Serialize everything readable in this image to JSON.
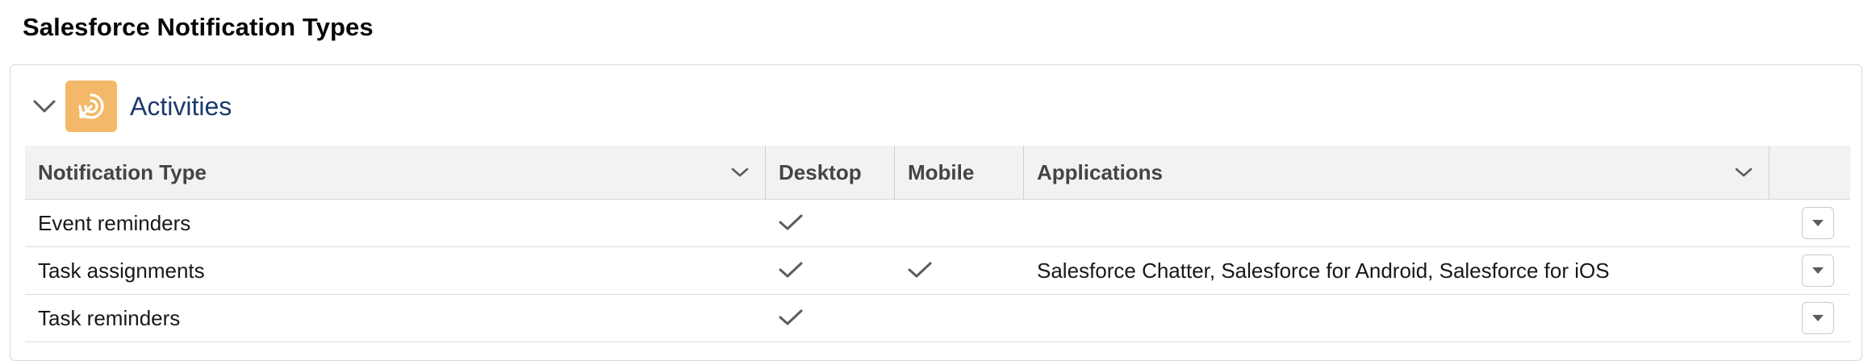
{
  "page": {
    "title": "Salesforce Notification Types"
  },
  "section": {
    "title": "Activities",
    "icon": "activity-icon",
    "collapse_icon": "chevron-down-icon",
    "accent_color": "#f3b968"
  },
  "table": {
    "columns": [
      {
        "label": "Notification Type",
        "sortable": true
      },
      {
        "label": "Desktop",
        "sortable": false
      },
      {
        "label": "Mobile",
        "sortable": false
      },
      {
        "label": "Applications",
        "sortable": true
      }
    ],
    "rows": [
      {
        "type": "Event reminders",
        "desktop": true,
        "mobile": false,
        "applications": ""
      },
      {
        "type": "Task assignments",
        "desktop": true,
        "mobile": true,
        "applications": "Salesforce Chatter, Salesforce for Android, Salesforce for iOS"
      },
      {
        "type": "Task reminders",
        "desktop": true,
        "mobile": false,
        "applications": ""
      }
    ],
    "row_action_icon": "dropdown-caret-icon"
  }
}
